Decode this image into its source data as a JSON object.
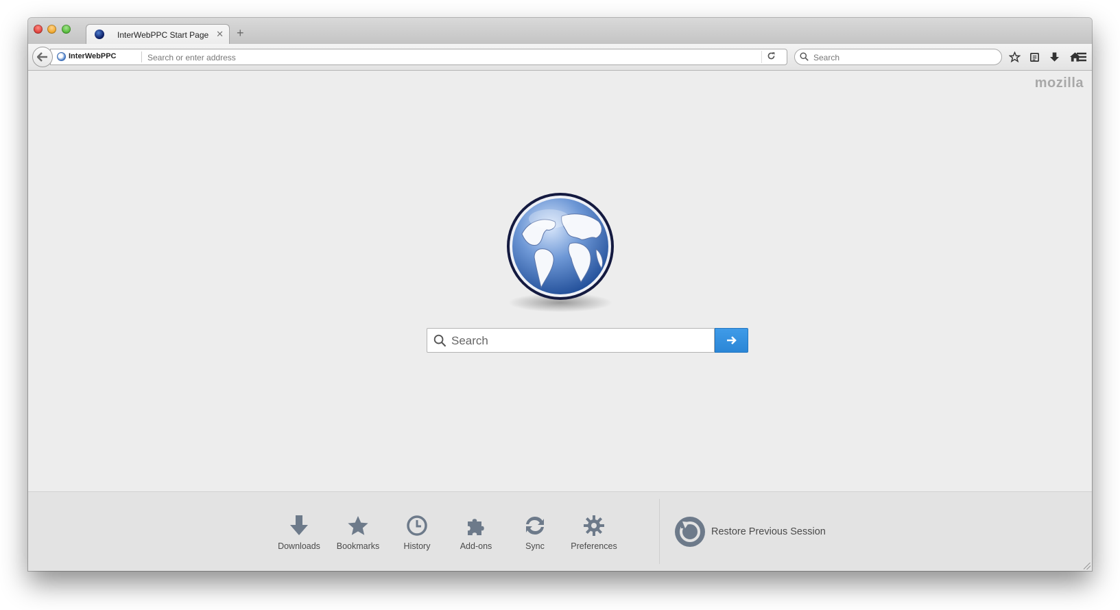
{
  "tab": {
    "title": "InterWebPPC Start Page",
    "close_glyph": "✕",
    "new_tab_glyph": "+"
  },
  "navbar": {
    "identity_label": "InterWebPPC",
    "url_placeholder": "Search or enter address",
    "search_placeholder": "Search"
  },
  "brand": "mozilla",
  "content": {
    "search_placeholder": "Search"
  },
  "launcher": {
    "items": [
      {
        "label": "Downloads",
        "icon": "download-icon"
      },
      {
        "label": "Bookmarks",
        "icon": "star-icon"
      },
      {
        "label": "History",
        "icon": "clock-icon"
      },
      {
        "label": "Add-ons",
        "icon": "puzzle-icon"
      },
      {
        "label": "Sync",
        "icon": "sync-icon"
      },
      {
        "label": "Preferences",
        "icon": "gear-icon"
      }
    ],
    "restore_label": "Restore Previous Session"
  },
  "colors": {
    "accent": "#2b86d6",
    "icon_gray": "#6d7a8a",
    "globe_blue": "#2f5fa8"
  }
}
